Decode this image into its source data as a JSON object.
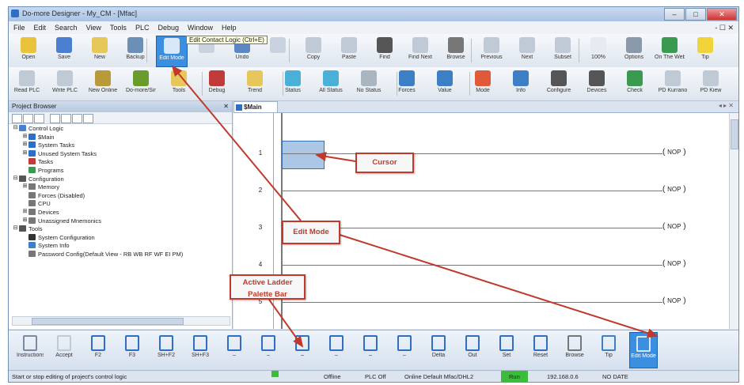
{
  "window": {
    "title": "Do-more Designer - My_CM - [Mfac]",
    "buttons": [
      "–",
      "□",
      "✕"
    ]
  },
  "menu": {
    "items": [
      "File",
      "Edit",
      "Search",
      "View",
      "Tools",
      "PLC",
      "Debug",
      "Window",
      "Help"
    ],
    "mdi": "- ☐ ✕"
  },
  "toolbar1": [
    {
      "label": "Open",
      "color": "#e9c33a"
    },
    {
      "label": "Save",
      "color": "#4a7fd0"
    },
    {
      "label": "New",
      "color": "#e7c65a"
    },
    {
      "label": "Backup",
      "color": "#6c8fb5"
    },
    {
      "label": "Edit Mode",
      "color": "#d9e8f8",
      "active": true
    },
    {
      "label": "",
      "color": "#c9d3df"
    },
    {
      "label": "Undo",
      "color": "#5c87c4"
    },
    {
      "label": "",
      "color": "#c9d3df"
    },
    {
      "label": "Copy",
      "color": "#c0cad6"
    },
    {
      "label": "Paste",
      "color": "#c0cad6"
    },
    {
      "label": "Find",
      "color": "#555"
    },
    {
      "label": "Find Next",
      "color": "#c0cad6"
    },
    {
      "label": "Browse",
      "color": "#777"
    },
    {
      "label": "Previous",
      "color": "#c0cad6"
    },
    {
      "label": "Next",
      "color": "#c0cad6"
    },
    {
      "label": "Subset",
      "color": "#c0cad6"
    },
    {
      "label": "100%",
      "color": "#e6ebf2"
    },
    {
      "label": "Options",
      "color": "#8a99aa"
    },
    {
      "label": "On The Web",
      "color": "#3a9a50"
    },
    {
      "label": "Tip",
      "color": "#f1d43a"
    }
  ],
  "tooltip": "Edit Contact Logic (Ctrl+E)",
  "toolbar2": [
    {
      "label": "Read PLC",
      "color": "#c0cad6"
    },
    {
      "label": "Write PLC",
      "color": "#c0cad6"
    },
    {
      "label": "New Online",
      "color": "#b89a3a"
    },
    {
      "label": "Do-more/Sim",
      "color": "#6a9c2c"
    },
    {
      "label": "Tools",
      "color": "#e7c65a"
    },
    {
      "label": "Debug",
      "color": "#c23b3b"
    },
    {
      "label": "Trend",
      "color": "#e7c65a"
    },
    {
      "label": "Status",
      "color": "#4ab0d8"
    },
    {
      "label": "All Status",
      "color": "#4ab0d8"
    },
    {
      "label": "No Status",
      "color": "#aab5c2"
    },
    {
      "label": "Forces",
      "color": "#3d7fc6"
    },
    {
      "label": "Value",
      "color": "#3d7fc6"
    },
    {
      "label": "Mode",
      "color": "#e05a3a"
    },
    {
      "label": "Info",
      "color": "#3d7fc6"
    },
    {
      "label": "Configure",
      "color": "#555"
    },
    {
      "label": "Devices",
      "color": "#555"
    },
    {
      "label": "Check",
      "color": "#3a9a50"
    },
    {
      "label": "PD Kurrano",
      "color": "#c0cad6"
    },
    {
      "label": "PD Kiew",
      "color": "#c0cad6"
    }
  ],
  "project_browser": {
    "header": "Project Browser",
    "close": "✕",
    "tree": [
      {
        "text": "Control Logic",
        "indent": 0,
        "expander": "⊟",
        "color": "#4a7fd0"
      },
      {
        "text": "$Main",
        "indent": 1,
        "expander": "⊞",
        "color": "#2d6fc5"
      },
      {
        "text": "System Tasks",
        "indent": 1,
        "expander": "⊞",
        "color": "#2d6fc5"
      },
      {
        "text": "Unused System Tasks",
        "indent": 1,
        "expander": "⊞",
        "color": "#2d6fc5"
      },
      {
        "text": "Tasks",
        "indent": 1,
        "expander": "",
        "color": "#c23b3b"
      },
      {
        "text": "Programs",
        "indent": 1,
        "expander": "",
        "color": "#3a9a50"
      },
      {
        "text": "Configuration",
        "indent": 0,
        "expander": "⊟",
        "color": "#555"
      },
      {
        "text": "Memory",
        "indent": 1,
        "expander": "⊞",
        "color": "#777"
      },
      {
        "text": "Forces (Disabled)",
        "indent": 1,
        "expander": "",
        "color": "#777"
      },
      {
        "text": "CPU",
        "indent": 1,
        "expander": "",
        "color": "#777"
      },
      {
        "text": "Devices",
        "indent": 1,
        "expander": "⊞",
        "color": "#777"
      },
      {
        "text": "Unassigned Mnemonics",
        "indent": 1,
        "expander": "⊞",
        "color": "#777"
      },
      {
        "text": "Tools",
        "indent": 0,
        "expander": "⊟",
        "color": "#555"
      },
      {
        "text": "System Configuration",
        "indent": 1,
        "expander": "",
        "color": "#333"
      },
      {
        "text": "System Info",
        "indent": 1,
        "expander": "",
        "color": "#3d7fc6"
      },
      {
        "text": "Password Config(Default View - RB WB RF WF EI PM)",
        "indent": 1,
        "expander": "",
        "color": "#777"
      }
    ]
  },
  "editor": {
    "tab": "$Main",
    "rungs": [
      {
        "num": "1",
        "instruction": "NOP"
      },
      {
        "num": "2",
        "instruction": "NOP"
      },
      {
        "num": "3",
        "instruction": "NOP"
      },
      {
        "num": "4",
        "instruction": "NOP"
      },
      {
        "num": "5",
        "instruction": "NOP"
      },
      {
        "num": "6",
        "instruction": "NOP"
      }
    ]
  },
  "palette": [
    {
      "label": "Instructions",
      "color": "#7a8aa0"
    },
    {
      "label": "Accept",
      "color": "#c0cad6"
    },
    {
      "label": "F2",
      "color": "#2d6fc5"
    },
    {
      "label": "F3",
      "color": "#2d6fc5"
    },
    {
      "label": "SH+F2",
      "color": "#2d6fc5"
    },
    {
      "label": "SH+F3",
      "color": "#2d6fc5"
    },
    {
      "label": "–",
      "color": "#2d6fc5"
    },
    {
      "label": "–",
      "color": "#2d6fc5"
    },
    {
      "label": "–",
      "color": "#2d6fc5"
    },
    {
      "label": "–",
      "color": "#2d6fc5"
    },
    {
      "label": "–",
      "color": "#2d6fc5"
    },
    {
      "label": "–",
      "color": "#2d6fc5"
    },
    {
      "label": "Delta",
      "color": "#2d6fc5"
    },
    {
      "label": "Out",
      "color": "#2d6fc5"
    },
    {
      "label": "Set",
      "color": "#2d6fc5"
    },
    {
      "label": "Reset",
      "color": "#2d6fc5"
    },
    {
      "label": "Browse",
      "color": "#777"
    },
    {
      "label": "Tip",
      "color": "#3d7fc6"
    },
    {
      "label": "Edit Mode",
      "color": "#d9e8f8",
      "active": true
    }
  ],
  "statusbar": {
    "hint": "Start or stop editing of project's control logic",
    "mode": "Offline",
    "plc": "PLC Off",
    "conn": "Online Default Mfac/DHL2",
    "run": "Run",
    "addr": "192.168.0.6",
    "ro": "NO DATE"
  },
  "callouts": {
    "cursor": "Cursor",
    "edit_mode": "Edit Mode",
    "palette": "Active Ladder Palette Bar"
  }
}
